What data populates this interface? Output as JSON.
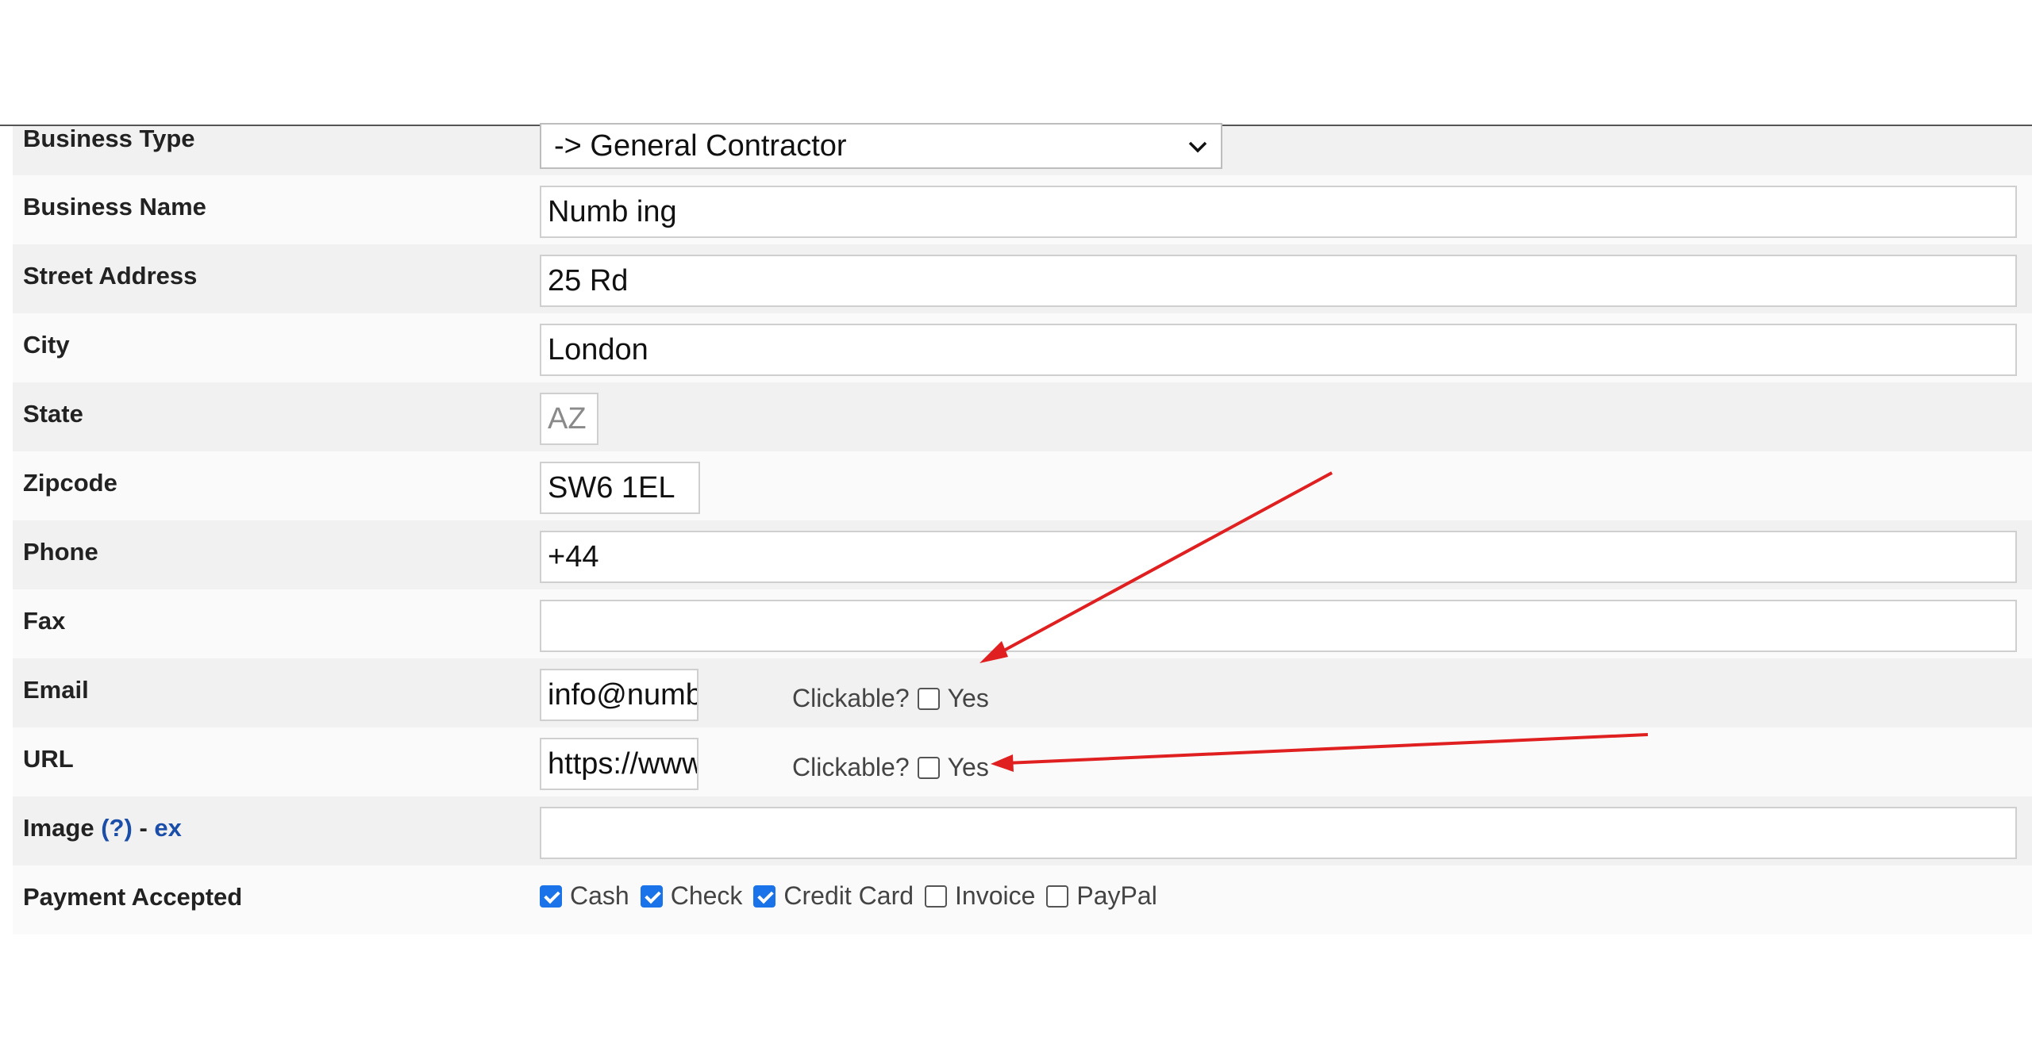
{
  "form": {
    "business_type": {
      "label": "Business Type",
      "value": "-> General Contractor"
    },
    "business_name": {
      "label": "Business Name",
      "value": "Numb        ing"
    },
    "street_address": {
      "label": "Street Address",
      "value": "25       Rd"
    },
    "city": {
      "label": "City",
      "value": "London"
    },
    "state": {
      "label": "State",
      "value": "AZ"
    },
    "zipcode": {
      "label": "Zipcode",
      "value": "SW6 1EL"
    },
    "phone": {
      "label": "Phone",
      "value": "+44"
    },
    "fax": {
      "label": "Fax",
      "value": ""
    },
    "email": {
      "label": "Email",
      "value": "info@numberon",
      "clickable_label": "Clickable?",
      "yes_label": "Yes",
      "clickable_checked": false
    },
    "url": {
      "label": "URL",
      "value": "https://www.num",
      "clickable_label": "Clickable?",
      "yes_label": "Yes",
      "clickable_checked": false
    },
    "image": {
      "label": "Image",
      "help_text": "(?)",
      "separator": "-",
      "example_text": "ex",
      "value": ""
    },
    "payment_accepted": {
      "label": "Payment Accepted",
      "options": [
        {
          "label": "Cash",
          "checked": true
        },
        {
          "label": "Check",
          "checked": true
        },
        {
          "label": "Credit Card",
          "checked": true
        },
        {
          "label": "Invoice",
          "checked": false
        },
        {
          "label": "PayPal",
          "checked": false
        }
      ]
    }
  },
  "annotations": {
    "arrow_color": "#e02020"
  },
  "colors": {
    "checkbox_checked": "#1a73e8",
    "link": "#1a4ea8"
  }
}
